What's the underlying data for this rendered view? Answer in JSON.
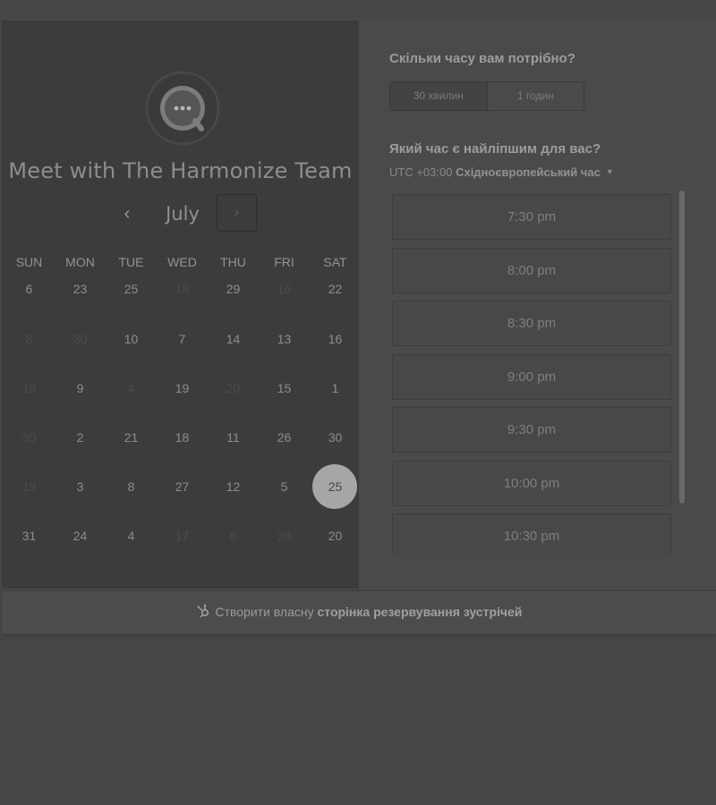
{
  "logo": "chat-bubble-logo-icon",
  "title": "Meet with The Harmonize Team",
  "calendar": {
    "month": "July",
    "prev_glyph": "‹",
    "next_glyph": "›",
    "weekdays": [
      "SUN",
      "MON",
      "TUE",
      "WED",
      "THU",
      "FRI",
      "SAT"
    ],
    "weeks": [
      [
        {
          "n": "6",
          "m": false
        },
        {
          "n": "23",
          "m": false
        },
        {
          "n": "25",
          "m": false
        },
        {
          "n": "18",
          "m": true
        },
        {
          "n": "29",
          "m": false
        },
        {
          "n": "16",
          "m": true
        },
        {
          "n": "22",
          "m": false
        }
      ],
      [
        {
          "n": "8",
          "m": true
        },
        {
          "n": "30",
          "m": true
        },
        {
          "n": "10",
          "m": false
        },
        {
          "n": "7",
          "m": false
        },
        {
          "n": "14",
          "m": false
        },
        {
          "n": "13",
          "m": false
        },
        {
          "n": "16",
          "m": false
        }
      ],
      [
        {
          "n": "19",
          "m": true
        },
        {
          "n": "9",
          "m": false
        },
        {
          "n": "4",
          "m": true
        },
        {
          "n": "19",
          "m": false
        },
        {
          "n": "20",
          "m": true
        },
        {
          "n": "15",
          "m": false
        },
        {
          "n": "1",
          "m": false
        }
      ],
      [
        {
          "n": "30",
          "m": true
        },
        {
          "n": "2",
          "m": false
        },
        {
          "n": "21",
          "m": false
        },
        {
          "n": "18",
          "m": false
        },
        {
          "n": "11",
          "m": false
        },
        {
          "n": "26",
          "m": false
        },
        {
          "n": "30",
          "m": false
        }
      ],
      [
        {
          "n": "19",
          "m": true
        },
        {
          "n": "3",
          "m": false
        },
        {
          "n": "8",
          "m": false
        },
        {
          "n": "27",
          "m": false
        },
        {
          "n": "12",
          "m": false
        },
        {
          "n": "5",
          "m": false
        },
        {
          "n": "25",
          "m": false,
          "selected": true
        }
      ],
      [
        {
          "n": "31",
          "m": false
        },
        {
          "n": "24",
          "m": false
        },
        {
          "n": "4",
          "m": false
        },
        {
          "n": "17",
          "m": true
        },
        {
          "n": "8",
          "m": true
        },
        {
          "n": "28",
          "m": true
        },
        {
          "n": "20",
          "m": false
        }
      ]
    ]
  },
  "duration": {
    "question": "Скільки часу вам потрібно?",
    "options": [
      "30 хвилин",
      "1 годин"
    ],
    "selected": "30 хвилин"
  },
  "time": {
    "question": "Який час є найліпшим для вас?",
    "tz_offset": "UTC +03:00",
    "tz_name": "Східноєвропейський час",
    "slots": [
      "7:30 pm",
      "8:00 pm",
      "8:30 pm",
      "9:00 pm",
      "9:30 pm",
      "10:00 pm",
      "10:30 pm"
    ]
  },
  "footer": {
    "prefix": "Створити власну",
    "link": "сторінка резервування зустрічей",
    "icon": "hubspot-sprocket-icon"
  }
}
